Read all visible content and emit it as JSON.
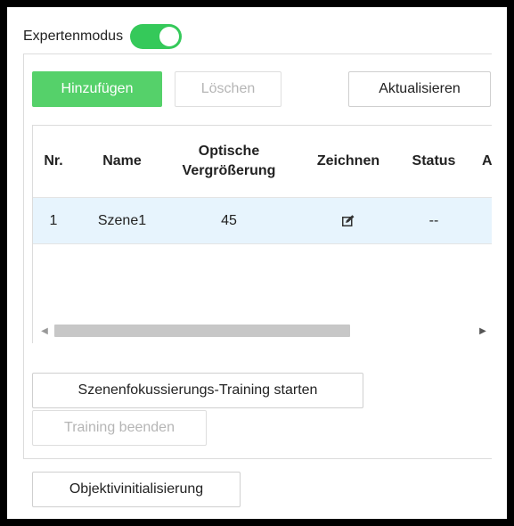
{
  "expert_mode": {
    "label": "Expertenmodus",
    "enabled": true,
    "accent": "#35c95a"
  },
  "toolbar": {
    "add_label": "Hinzufügen",
    "delete_label": "Löschen",
    "refresh_label": "Aktualisieren"
  },
  "table": {
    "headers": {
      "nr": "Nr.",
      "name": "Name",
      "zoom_line1": "Optische",
      "zoom_line2": "Vergrößerung",
      "draw": "Zeichnen",
      "status": "Status"
    },
    "rows": [
      {
        "nr": "1",
        "name": "Szene1",
        "zoom": "45",
        "draw_icon": "edit-icon",
        "status": "--"
      }
    ]
  },
  "training": {
    "start_label": "Szenenfokussierungs-Training starten",
    "stop_label": "Training beenden"
  },
  "lens_init_label": "Objektivinitialisierung",
  "colors": {
    "primary": "#55d16a",
    "selected_row": "#e7f4fd",
    "disabled_text": "#b5b5b5"
  }
}
